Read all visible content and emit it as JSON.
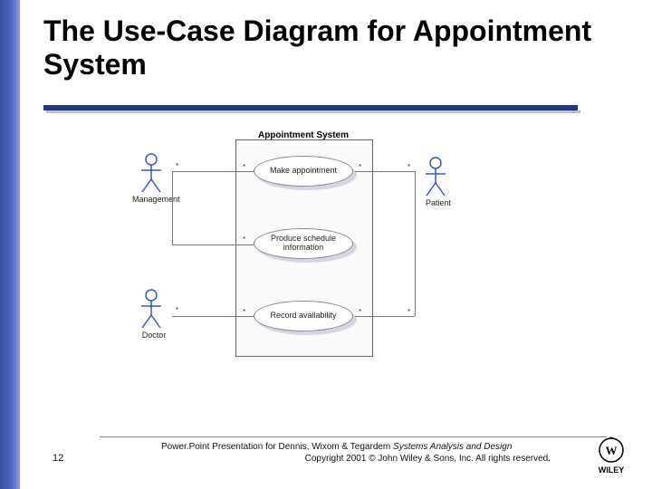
{
  "title": "The Use-Case Diagram for Appointment System",
  "diagram": {
    "system_name": "Appointment System",
    "uc1": "Make appointment",
    "uc2": "Produce schedule information",
    "uc3": "Record availability",
    "actor_mgmt": "Management",
    "actor_doc": "Doctor",
    "actor_pat": "Patient"
  },
  "footer": {
    "slide_number": "12",
    "line1_left": "Power.Point Presentation for Dennis, Wixom & Tegardem ",
    "book_title": "Systems Analysis and Design",
    "line2": "Copyright 2001 © John Wiley & Sons, Inc. All rights reserved."
  },
  "brand": "WILEY"
}
